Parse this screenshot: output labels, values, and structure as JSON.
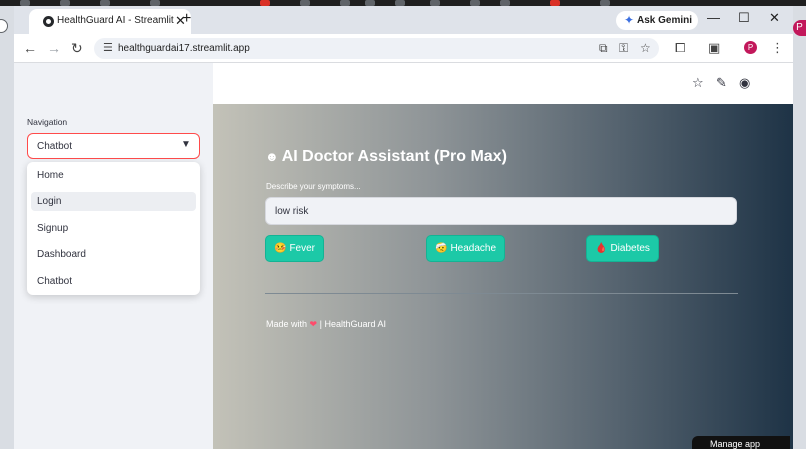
{
  "browser": {
    "tab_title": "HealthGuard AI - Streamlit",
    "tab_close": "✕",
    "new_tab": "+",
    "url": "healthguardai17.streamlit.app",
    "gemini_label": "Ask Gemini",
    "profile_initial": "P",
    "window_controls": {
      "minimize": "—",
      "maximize": "☐",
      "close": "✕"
    }
  },
  "sidebar": {
    "nav_label": "Navigation",
    "select_value": "Chatbot",
    "options": [
      {
        "label": "Home"
      },
      {
        "label": "Login"
      },
      {
        "label": "Signup"
      },
      {
        "label": "Dashboard"
      },
      {
        "label": "Chatbot"
      }
    ],
    "highlighted_option": "Login"
  },
  "main": {
    "title_icon": "☻",
    "title": "AI Doctor Assistant (Pro Max)",
    "symptoms_label": "Describe your symptoms...",
    "symptoms_value": "low risk",
    "buttons": [
      {
        "emoji": "🤒",
        "label": "Fever"
      },
      {
        "emoji": "🤕",
        "label": "Headache"
      },
      {
        "emoji": "🩸",
        "label": "Diabetes"
      }
    ],
    "footer_prefix": "Made with",
    "footer_heart": "❤",
    "footer_suffix": "| HealthGuard AI",
    "manage_app": "Manage app"
  },
  "colors": {
    "accent": "#ff4b4b",
    "chip": "#1cc9a7",
    "gradient_start": "#c3c2b8",
    "gradient_end": "#1e3346"
  }
}
